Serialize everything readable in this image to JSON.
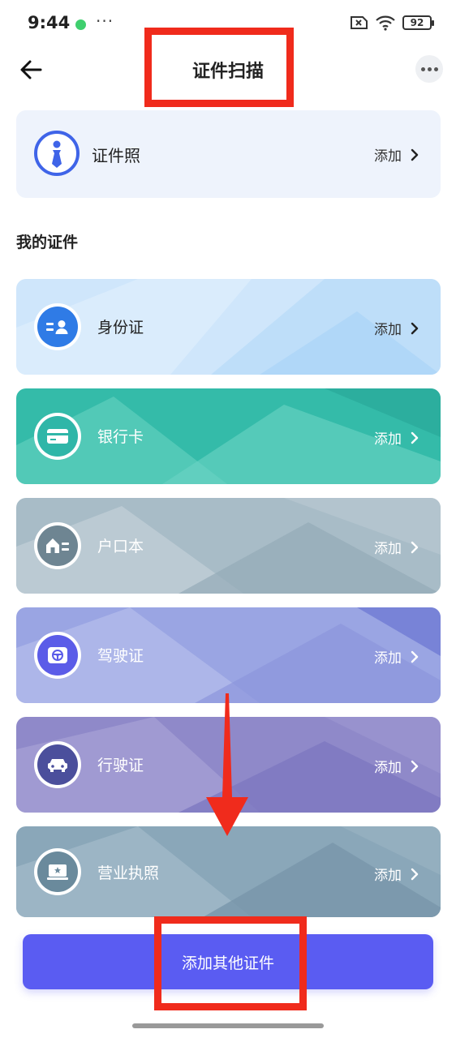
{
  "status_bar": {
    "time": "9:44",
    "more": "···",
    "battery": "92"
  },
  "header": {
    "title": "证件扫描"
  },
  "photo_card": {
    "label": "证件照",
    "action": "添加"
  },
  "section": {
    "title": "我的证件"
  },
  "documents": [
    {
      "label": "身份证",
      "action": "添加"
    },
    {
      "label": "银行卡",
      "action": "添加"
    },
    {
      "label": "户口本",
      "action": "添加"
    },
    {
      "label": "驾驶证",
      "action": "添加"
    },
    {
      "label": "行驶证",
      "action": "添加"
    },
    {
      "label": "营业执照",
      "action": "添加"
    }
  ],
  "footer": {
    "add_other_label": "添加其他证件"
  },
  "colors": {
    "accent": "#5a5cf2",
    "highlight": "#f02b1c",
    "id_card": "#2f7be6",
    "bank_card": "#2fb6a8",
    "household": "#6e8592",
    "license": "#5b5ce8",
    "vehicle": "#4b4f9c",
    "business": "#6a8a9c"
  }
}
